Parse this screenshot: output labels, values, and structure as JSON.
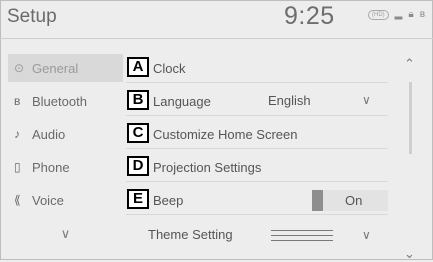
{
  "header": {
    "title": "Setup",
    "time": "9:25",
    "status_icons": [
      "hd-badge",
      "signal-icon",
      "lock-icon",
      "bluetooth-icon"
    ],
    "badge_text": "(HD)"
  },
  "sidebar": {
    "items": [
      {
        "label": "General",
        "icon": "gear-icon",
        "glyph": "⊙",
        "active": true
      },
      {
        "label": "Bluetooth",
        "icon": "bluetooth-icon",
        "glyph": "ʙ",
        "active": false
      },
      {
        "label": "Audio",
        "icon": "music-note-icon",
        "glyph": "♪",
        "active": false
      },
      {
        "label": "Phone",
        "icon": "phone-icon",
        "glyph": "▯",
        "active": false
      },
      {
        "label": "Voice",
        "icon": "voice-icon",
        "glyph": "⟪",
        "active": false
      }
    ],
    "more_glyph": "∨"
  },
  "settings": {
    "rows": [
      {
        "callout": "A",
        "text": "Clock"
      },
      {
        "callout": "B",
        "text": "Language",
        "value": "English"
      },
      {
        "callout": "C",
        "text": "Customize Home Screen"
      },
      {
        "callout": "D",
        "text": "Projection Settings"
      },
      {
        "callout": "E",
        "text": "Beep",
        "toggle": "On"
      }
    ],
    "theme_label": "Theme Setting"
  },
  "scroll": {
    "up": "⌃",
    "down": "⌄"
  },
  "colors": {
    "background": "#ededed",
    "active_item": "#d9d9d9",
    "toggle_knob": "#8e8e8e"
  }
}
